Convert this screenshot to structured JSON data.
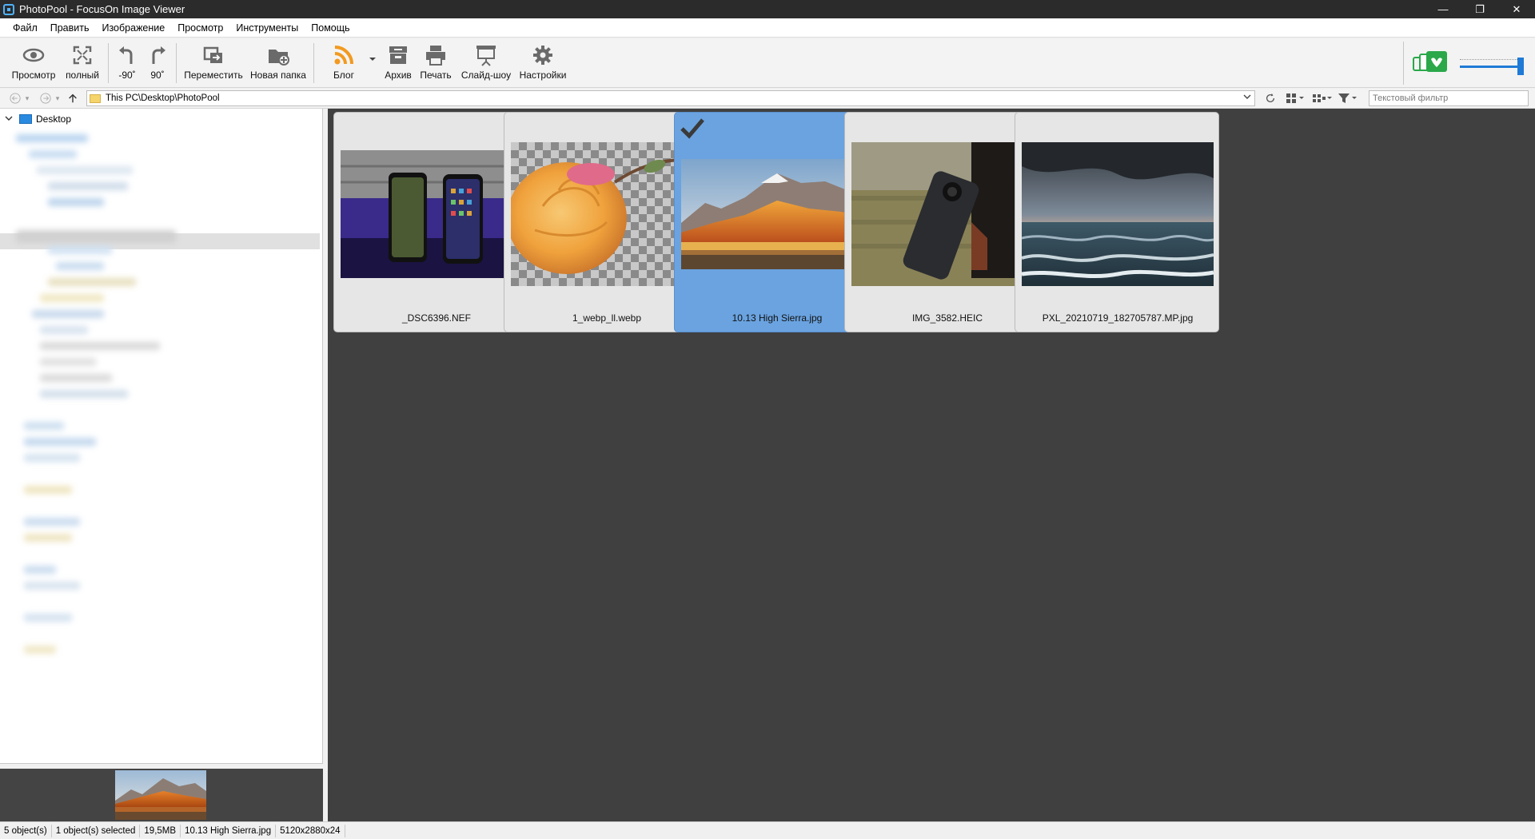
{
  "window": {
    "title": "PhotoPool - FocusOn Image Viewer",
    "minimize": "—",
    "restore": "❐",
    "close": "✕"
  },
  "menu": [
    "Файл",
    "Править",
    "Изображение",
    "Просмотр",
    "Инструменты",
    "Помощь"
  ],
  "toolbar": {
    "view": "Просмотр",
    "fullscreen": "полный",
    "rotate_left": "-90˚",
    "rotate_right": "90˚",
    "move": "Переместить",
    "new_folder": "Новая папка",
    "blog": "Блог",
    "archive": "Архив",
    "print": "Печать",
    "slideshow": "Слайд-шоу",
    "settings": "Настройки"
  },
  "address": {
    "path": "This PC\\Desktop\\PhotoPool",
    "filter_placeholder": "Текстовый фильтр"
  },
  "tree": {
    "root": "Desktop"
  },
  "thumbnails": [
    {
      "name": "_DSC6396.NEF",
      "selected": false
    },
    {
      "name": "1_webp_ll.webp",
      "selected": false
    },
    {
      "name": "10.13 High Sierra.jpg",
      "selected": true
    },
    {
      "name": "IMG_3582.HEIC",
      "selected": false
    },
    {
      "name": "PXL_20210719_182705787.MP.jpg",
      "selected": false
    }
  ],
  "status": {
    "objects": "5 object(s)",
    "selected": "1 object(s) selected",
    "size": "19,5MB",
    "file": "10.13 High Sierra.jpg",
    "dimensions": "5120x2880x24"
  },
  "colors": {
    "accent": "#1f7ad6",
    "selection": "#6aa3e0",
    "thumb_bg": "#404040"
  }
}
